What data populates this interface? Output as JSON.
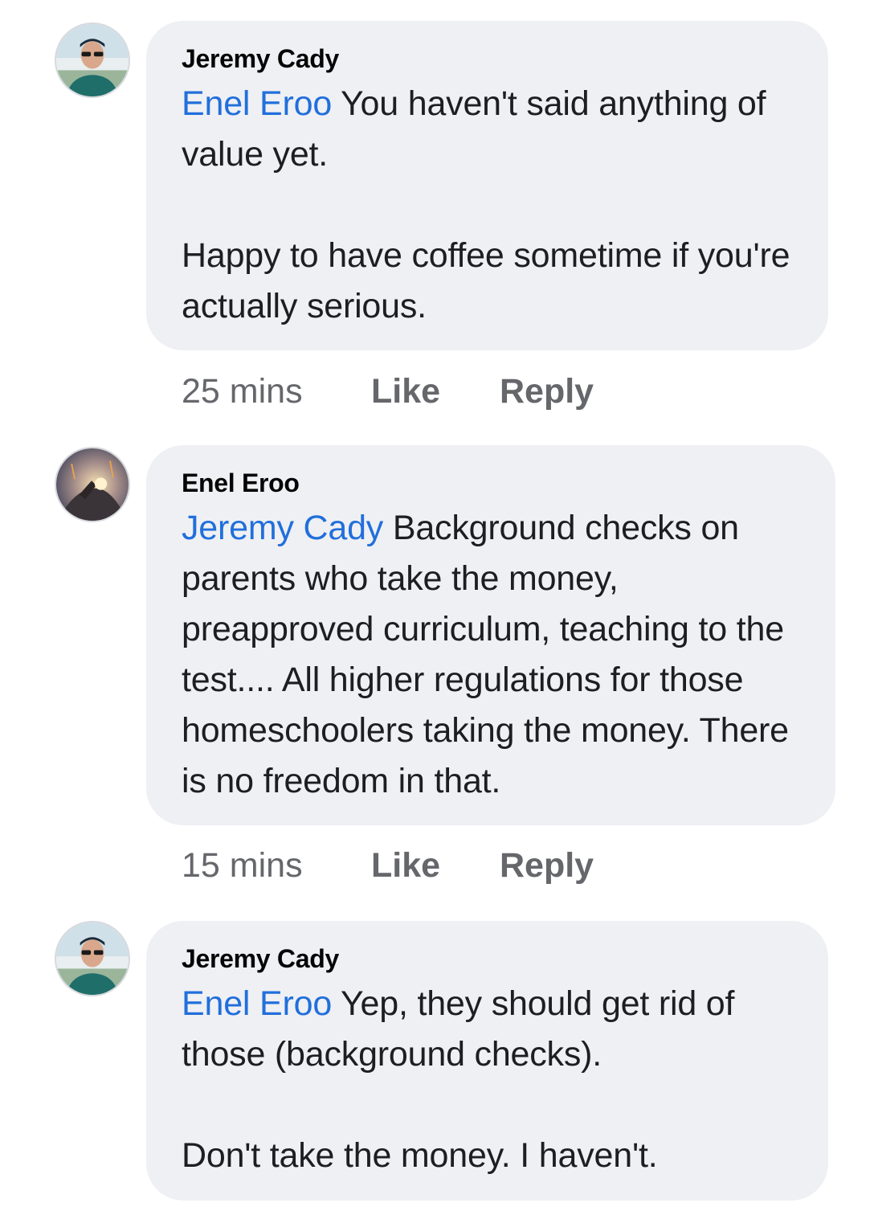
{
  "comments": [
    {
      "author": "Jeremy Cady",
      "mention": "Enel Eroo",
      "text": " You haven't said anything of value yet.\n\nHappy to have coffee sometime if you're actually serious.",
      "time": "25 mins",
      "like": "Like",
      "reply": "Reply",
      "avatar_icon": "man-with-sunglasses-avatar"
    },
    {
      "author": "Enel Eroo",
      "mention": "Jeremy Cady",
      "text": " Background checks on parents who take the money, preapproved curriculum, teaching to the test.... All higher regulations for those homeschoolers taking the money. There is no freedom in that.",
      "time": "15 mins",
      "like": "Like",
      "reply": "Reply",
      "avatar_icon": "fantasy-scene-avatar"
    },
    {
      "author": "Jeremy Cady",
      "mention": "Enel Eroo",
      "text": " Yep, they should get rid of those (background checks).\n\nDon't take the money. I haven't.",
      "avatar_icon": "man-with-sunglasses-avatar"
    }
  ],
  "colors": {
    "bubble": "#eff0f4",
    "mention": "#216fdb",
    "meta": "#65676b"
  }
}
